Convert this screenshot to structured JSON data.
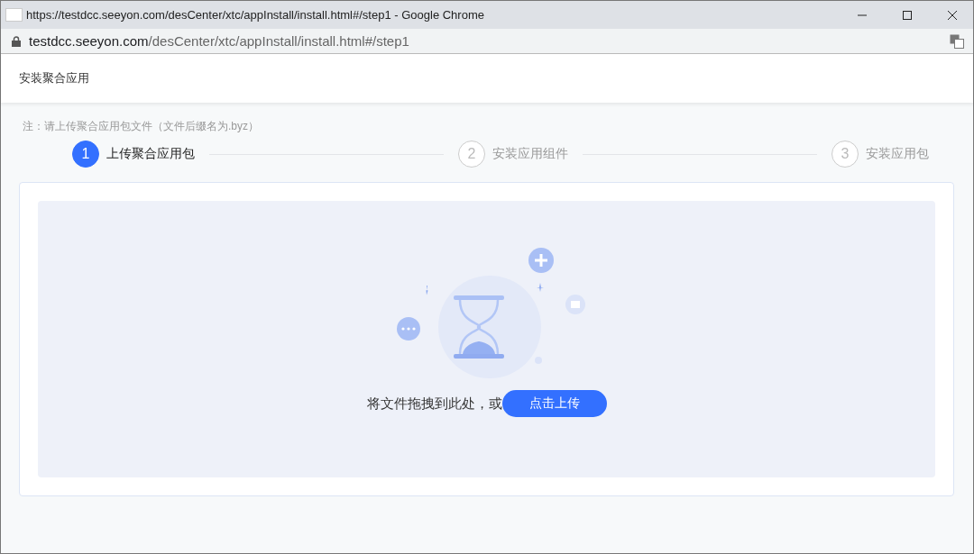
{
  "window": {
    "title": "https://testdcc.seeyon.com/desCenter/xtc/appInstall/install.html#/step1 - Google Chrome"
  },
  "address_bar": {
    "host": "testdcc.seeyon.com",
    "path": "/desCenter/xtc/appInstall/install.html#/step1"
  },
  "header": {
    "title": "安装聚合应用"
  },
  "note": "注：请上传聚合应用包文件（文件后缀名为.byz）",
  "steps": [
    {
      "number": "1",
      "label": "上传聚合应用包",
      "selected": true
    },
    {
      "number": "2",
      "label": "安装应用组件",
      "selected": false
    },
    {
      "number": "3",
      "label": "安装应用包",
      "selected": false
    }
  ],
  "dropzone": {
    "hint": "将文件拖拽到此处，或",
    "button": "点击上传"
  }
}
